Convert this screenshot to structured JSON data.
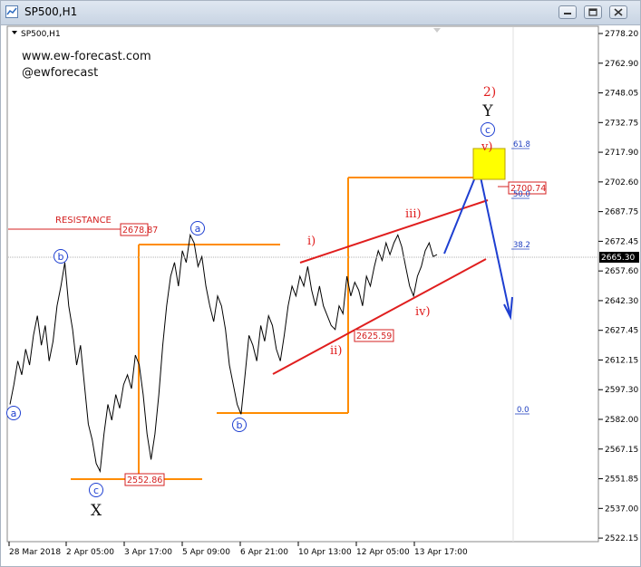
{
  "window": {
    "title": "SP500,H1",
    "chart_label": "SP500,H1",
    "minimize": "minimize",
    "restore": "restore",
    "close": "close"
  },
  "watermark": {
    "site": "www.ew-forecast.com",
    "handle": "@ewforecast"
  },
  "annotations": {
    "resistance": "RESISTANCE",
    "wave_a": "a",
    "wave_b": "b",
    "wave_c": "c",
    "wave_X": "X",
    "wave_Y": "Y",
    "wave_2": "2)",
    "wave_i": "i)",
    "wave_ii": "ii)",
    "wave_iii": "iii)",
    "wave_iv": "iv)",
    "wave_v": "v)",
    "fib_618": "61.8",
    "fib_500": "50.0",
    "fib_382": "38.2",
    "fib_00": "0.0"
  },
  "chart_data": {
    "type": "line",
    "symbol": "SP500",
    "timeframe": "H1",
    "y_ticks": [
      "2778.20",
      "2762.90",
      "2748.05",
      "2732.75",
      "2717.90",
      "2702.60",
      "2687.75",
      "2672.45",
      "2657.60",
      "2642.30",
      "2627.45",
      "2612.15",
      "2597.30",
      "2582.00",
      "2567.15",
      "2551.85",
      "2537.00",
      "2522.15"
    ],
    "ylim": [
      2522.15,
      2778.2
    ],
    "current_price": "2665.30",
    "x_ticks": [
      "28 Mar 2018",
      "2 Apr 05:00",
      "3 Apr 17:00",
      "5 Apr 09:00",
      "6 Apr 21:00",
      "10 Apr 13:00",
      "12 Apr 05:00",
      "13 Apr 17:00"
    ],
    "price_labels": [
      "2678.87",
      "2552.86",
      "2625.59",
      "2700.74"
    ],
    "series": [
      {
        "values": [
          2590,
          2600,
          2612,
          2605,
          2618,
          2610,
          2625,
          2635,
          2620,
          2630,
          2612,
          2622,
          2640,
          2650,
          2662,
          2640,
          2628,
          2610,
          2620,
          2600,
          2580,
          2572,
          2560,
          2556,
          2575,
          2590,
          2582,
          2595,
          2588,
          2600,
          2605,
          2598,
          2615,
          2610,
          2595,
          2575,
          2562,
          2575,
          2595,
          2620,
          2640,
          2655,
          2662,
          2650,
          2668,
          2662,
          2676,
          2672,
          2660,
          2665,
          2650,
          2640,
          2632,
          2645,
          2640,
          2628,
          2610,
          2600,
          2590,
          2585,
          2605,
          2625,
          2620,
          2612,
          2630,
          2622,
          2635,
          2630,
          2618,
          2612,
          2625,
          2640,
          2650,
          2645,
          2655,
          2650,
          2660,
          2648,
          2640,
          2650,
          2640,
          2635,
          2630,
          2628,
          2640,
          2636,
          2655,
          2645,
          2652,
          2648,
          2640,
          2655,
          2650,
          2660,
          2668,
          2663,
          2672,
          2666,
          2672,
          2676,
          2670,
          2660,
          2650,
          2645,
          2655,
          2660,
          2668,
          2672,
          2665,
          2666
        ]
      }
    ],
    "grid": false
  }
}
